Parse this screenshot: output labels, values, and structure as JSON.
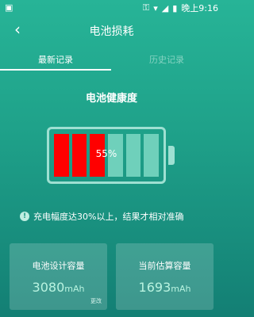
{
  "status_bar": {
    "left_icon": "image-notification-icon",
    "time": "晚上9:16"
  },
  "app_bar": {
    "back_icon": "back-arrow-icon",
    "title": "电池损耗"
  },
  "tabs": [
    {
      "label": "最新记录",
      "active": true
    },
    {
      "label": "历史记录",
      "active": false
    }
  ],
  "battery": {
    "title": "电池健康度",
    "percent_text": "55%",
    "health_percent": 55,
    "cells_total": 6,
    "cells_filled": 3,
    "fill_color": "#ff0000",
    "empty_color": "#6fd0bb"
  },
  "notice": {
    "icon": "exclamation-icon",
    "text": "充电幅度达30%以上，结果才相对准确"
  },
  "cards": [
    {
      "label": "电池设计容量",
      "value": "3080",
      "unit": "mAh",
      "action": "更改"
    },
    {
      "label": "当前估算容量",
      "value": "1693",
      "unit": "mAh"
    }
  ],
  "colors": {
    "background_top": "#27b497",
    "background_bottom": "#137f74"
  }
}
